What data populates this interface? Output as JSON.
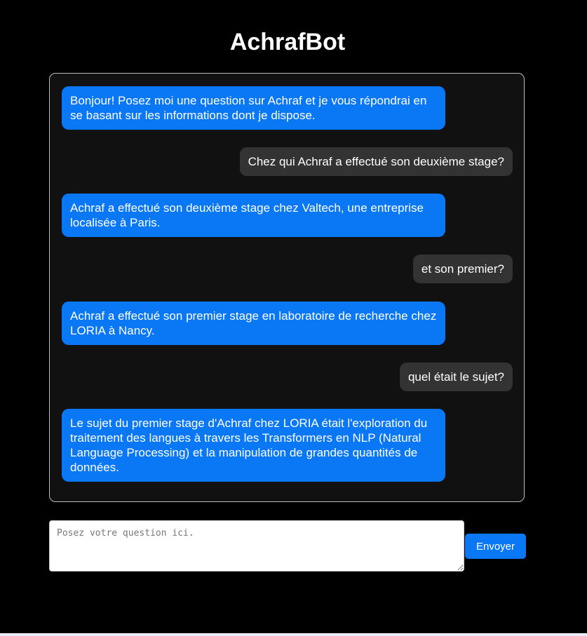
{
  "header": {
    "title": "AchrafBot"
  },
  "chat": {
    "messages": [
      {
        "role": "bot",
        "text": "Bonjour! Posez moi une question sur Achraf et je vous répondrai en se basant sur les informations dont je dispose."
      },
      {
        "role": "user",
        "text": "Chez qui Achraf a effectué son deuxième stage?"
      },
      {
        "role": "bot",
        "text": "Achraf a effectué son deuxième stage chez Valtech, une entreprise localisée à Paris."
      },
      {
        "role": "user",
        "text": "et son premier?"
      },
      {
        "role": "bot",
        "text": "Achraf a effectué son premier stage en laboratoire de recherche chez LORIA à Nancy."
      },
      {
        "role": "user",
        "text": "quel était le sujet?"
      },
      {
        "role": "bot",
        "text": "Le sujet du premier stage d'Achraf chez LORIA était l'exploration du traitement des langues à travers les Transformers en NLP (Natural Language Processing) et la manipulation de grandes quantités de données."
      }
    ]
  },
  "composer": {
    "value": "",
    "placeholder": "Posez votre question ici.",
    "send_label": "Envoyer"
  },
  "colors": {
    "background": "#000000",
    "chat_background": "#111111",
    "bot_bubble": "#0a78f5",
    "user_bubble": "#333333",
    "accent": "#0a78f5"
  }
}
